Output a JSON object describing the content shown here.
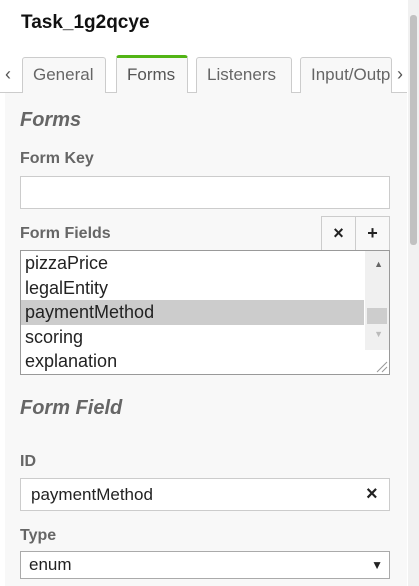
{
  "title": "Task_1g2qcye",
  "tabs": [
    "General",
    "Forms",
    "Listeners",
    "Input/Outp"
  ],
  "active_tab": "Forms",
  "nav": {
    "prev": "‹",
    "next": "›"
  },
  "forms_header": "Forms",
  "form_key": {
    "label": "Form Key",
    "value": ""
  },
  "form_fields": {
    "label": "Form Fields",
    "remove": "×",
    "add": "+",
    "items": [
      "pizzaPrice",
      "legalEntity",
      "paymentMethod",
      "scoring",
      "explanation"
    ],
    "selected": "paymentMethod"
  },
  "form_field_header": "Form Field",
  "id": {
    "label": "ID",
    "value": "paymentMethod",
    "clear": "×"
  },
  "type": {
    "label": "Type",
    "value": "enum",
    "arrow": "▼"
  }
}
